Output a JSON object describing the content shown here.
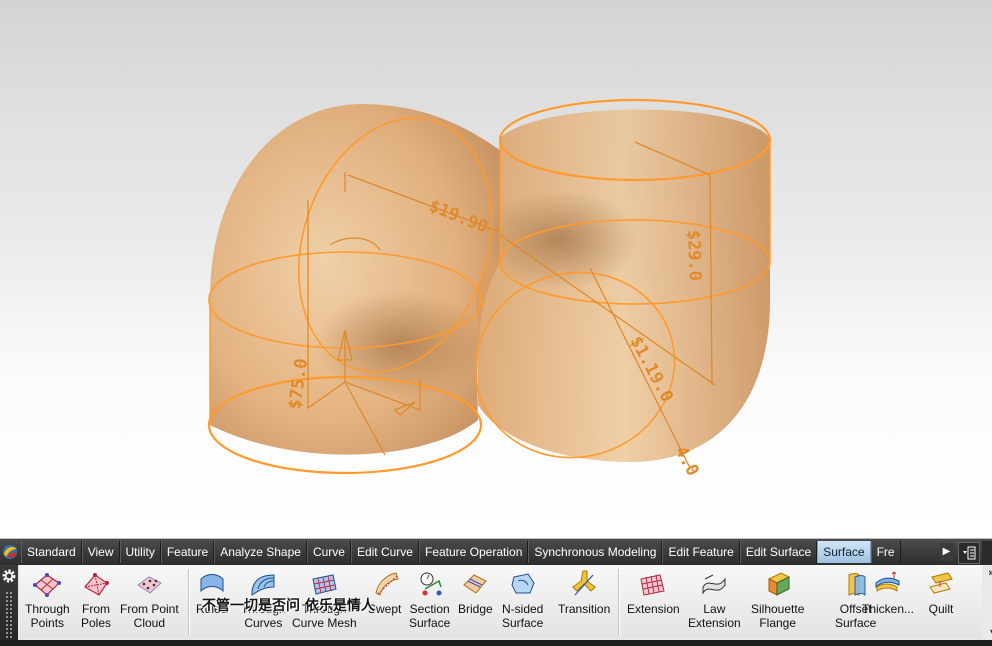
{
  "viewport": {
    "dimensions": [
      "$19.90",
      "$75.0",
      "$29.0",
      "$1.19.0",
      "4.0"
    ]
  },
  "ribbon": {
    "tabs": [
      {
        "label": "Standard"
      },
      {
        "label": "View"
      },
      {
        "label": "Utility"
      },
      {
        "label": "Feature"
      },
      {
        "label": "Analyze Shape"
      },
      {
        "label": "Curve"
      },
      {
        "label": "Edit Curve"
      },
      {
        "label": "Feature Operation"
      },
      {
        "label": "Synchronous Modeling"
      },
      {
        "label": "Edit Feature"
      },
      {
        "label": "Edit Surface"
      },
      {
        "label": "Surface"
      },
      {
        "label": "Fre"
      }
    ],
    "active_tab": "Surface",
    "commands": {
      "through_points": "Through\nPoints",
      "from_poles": "From\nPoles",
      "from_point_cloud": "From Point\nCloud",
      "ruled": "Ruled",
      "through_curves": "Through\nCurves",
      "through_curve_mesh": "Through\nCurve Mesh",
      "swept": "Swept",
      "section_surface": "Section\nSurface",
      "bridge": "Bridge",
      "n_sided_surface": "N-sided\nSurface",
      "transition": "Transition",
      "extension": "Extension",
      "law_extension": "Law\nExtension",
      "silhouette_flange": "Silhouette\nFlange",
      "offset_surface": "Offset\nSurface",
      "thicken": "Thicken...",
      "quilt": "Quilt"
    },
    "overlay_text": "不管一切是否问 依乐是情人",
    "colors": {
      "model_fill": "#e3a868",
      "model_edge": "#ff9a2e",
      "active_tab": "#b8d6ef"
    }
  }
}
